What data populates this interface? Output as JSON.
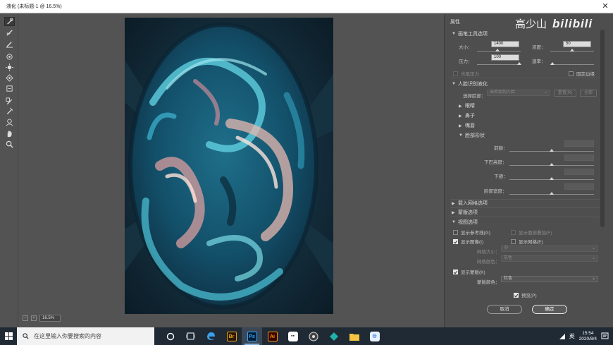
{
  "window": {
    "title": "液化 (未标题-1 @ 16.5%)",
    "close": "✕"
  },
  "canvas": {
    "zoom": "16.5%"
  },
  "panel": {
    "title": "属性",
    "watermark": {
      "text_cn": "高少山",
      "text_logo": "bilibili"
    },
    "brush": {
      "section": "画笔工具选项",
      "size_label": "大小：",
      "size_value": "1400",
      "density_label": "浓度：",
      "density_value": "50",
      "pressure_label": "压力：",
      "pressure_value": "100",
      "rate_label": "速率：",
      "stylus_label": "光笔压力",
      "pin_edges_label": "固定边缘"
    },
    "face": {
      "section": "人脸识别液化",
      "select_label": "选择脸部：",
      "select_value": "未检测到人脸",
      "reset_label": "重置(R)",
      "all_label": "全部",
      "items": [
        "眼睛",
        "鼻子",
        "嘴唇",
        "脸部形状"
      ],
      "shape_fields": [
        "前额：",
        "下巴高度：",
        "下颌：",
        "脸部宽度："
      ]
    },
    "mesh_section": "载入网格选项",
    "mask_section": "蒙版选项",
    "view": {
      "section": "视图选项",
      "guides_label": "显示参考线(G)",
      "face_overlay_label": "显示面部叠加(F)",
      "image_label": "显示图像(I)",
      "mesh_label": "显示网格(E)",
      "mesh_size_label": "网格大小：",
      "mesh_size_value": "中",
      "mesh_color_label": "网格颜色：",
      "mesh_color_value": "灰色",
      "show_mask_label": "显示蒙版(K)",
      "mask_color_label": "蒙版颜色：",
      "mask_color_value": "红色"
    },
    "preview_label": "预览(P)",
    "cancel_label": "取消",
    "ok_label": "确定"
  },
  "taskbar": {
    "search_placeholder": "在这里输入你要搜索的内容",
    "apps": [
      {
        "name": "Ps",
        "color": "#31a8ff",
        "bg": "#001e36"
      },
      {
        "name": "Ai",
        "color": "#ff9a00",
        "bg": "#330000"
      }
    ],
    "ime": "英",
    "time": "15:54",
    "date": "2020/8/4"
  }
}
